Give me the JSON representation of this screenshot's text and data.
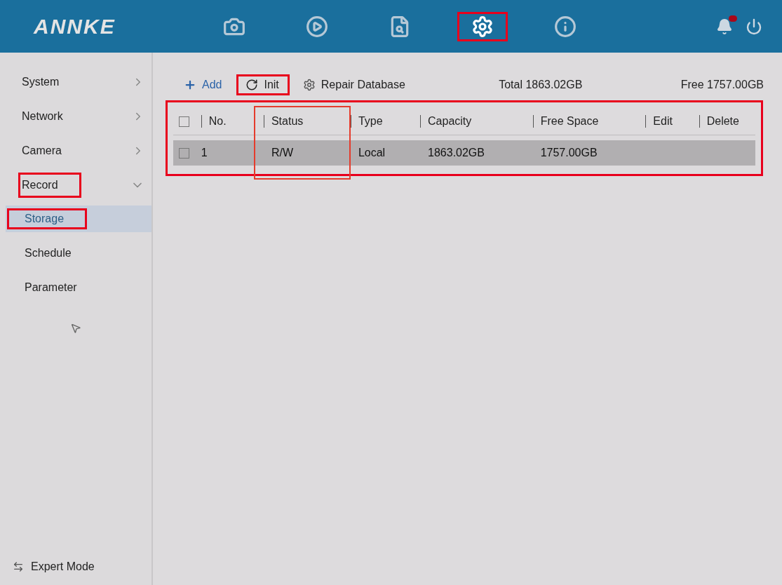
{
  "header": {
    "logo": "ANNKE",
    "nav": [
      {
        "kind": "camera",
        "selected": false,
        "highlighted": false
      },
      {
        "kind": "playback",
        "selected": false,
        "highlighted": false
      },
      {
        "kind": "search",
        "selected": false,
        "highlighted": false
      },
      {
        "kind": "settings",
        "selected": true,
        "highlighted": true
      },
      {
        "kind": "info",
        "selected": false,
        "highlighted": false
      }
    ],
    "alert": true
  },
  "sidebar": {
    "items": [
      {
        "label": "System",
        "expanded": false,
        "highlighted": false
      },
      {
        "label": "Network",
        "expanded": false,
        "highlighted": false
      },
      {
        "label": "Camera",
        "expanded": false,
        "highlighted": false
      },
      {
        "label": "Record",
        "expanded": true,
        "highlighted": true,
        "children": [
          {
            "label": "Storage",
            "selected": true,
            "highlighted": true
          },
          {
            "label": "Schedule",
            "selected": false,
            "highlighted": false
          },
          {
            "label": "Parameter",
            "selected": false,
            "highlighted": false
          }
        ]
      }
    ],
    "footer": "Expert Mode"
  },
  "toolbar": {
    "buttons": [
      {
        "kind": "add",
        "label": "Add",
        "highlighted": false
      },
      {
        "kind": "init",
        "label": "Init",
        "highlighted": true
      },
      {
        "kind": "repair",
        "label": "Repair Database",
        "highlighted": false
      }
    ],
    "total": "Total 1863.02GB",
    "free": "Free 1757.00GB"
  },
  "table": {
    "highlighted": true,
    "columns": [
      {
        "label": "No.",
        "highlighted": false
      },
      {
        "label": "Status",
        "highlighted": true
      },
      {
        "label": "Type",
        "highlighted": false
      },
      {
        "label": "Capacity",
        "highlighted": false
      },
      {
        "label": "Free Space",
        "highlighted": false
      },
      {
        "label": "Edit",
        "highlighted": false
      },
      {
        "label": "Delete",
        "highlighted": false
      }
    ],
    "all_checked": false,
    "rows": [
      {
        "checked": false,
        "cells": [
          "1",
          "R/W",
          "Local",
          "1863.02GB",
          "1757.00GB",
          "",
          ""
        ]
      }
    ]
  }
}
